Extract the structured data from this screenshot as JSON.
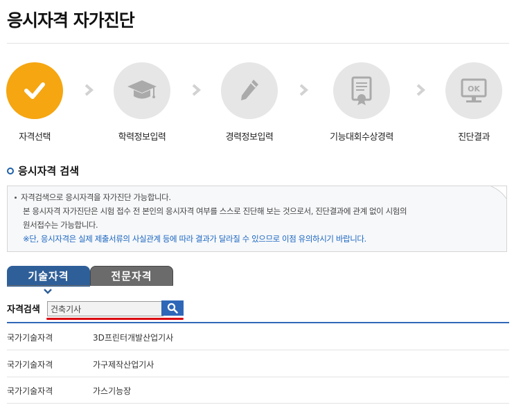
{
  "page": {
    "title": "응시자격 자가진단"
  },
  "steps": [
    {
      "label": "자격선택",
      "icon": "check-icon",
      "active": true
    },
    {
      "label": "학력정보입력",
      "icon": "graduation-cap-icon",
      "active": false
    },
    {
      "label": "경력정보입력",
      "icon": "pencil-icon",
      "active": false
    },
    {
      "label": "기능대회수상경력",
      "icon": "certificate-icon",
      "active": false
    },
    {
      "label": "진단결과",
      "icon": "monitor-ok-icon",
      "active": false
    }
  ],
  "monitor_text": "OK",
  "section": {
    "title": "응시자격 검색"
  },
  "notice": {
    "line1": "자격검색으로 응시자격을 자가진단 가능합니다.",
    "line2": "본 응시자격 자가진단은 시험 접수 전 본인의 응시자격 여부를 스스로 진단해 보는 것으로서, 진단결과에 관계 없이 시험의",
    "line3": "원서접수는 가능합니다.",
    "line4": "※단, 응시자격은 실제 제출서류의 사실관계 등에 따라 결과가 달라질 수 있으므로 이점 유의하시기 바랍니다."
  },
  "tabs": [
    {
      "label": "기술자격",
      "active": true
    },
    {
      "label": "전문자격",
      "active": false
    }
  ],
  "search": {
    "label": "자격검색",
    "value": "건축기사",
    "button_icon": "search-icon"
  },
  "results": [
    {
      "category": "국가기술자격",
      "name": "3D프린터개발산업기사"
    },
    {
      "category": "국가기술자격",
      "name": "가구제작산업기사"
    },
    {
      "category": "국가기술자격",
      "name": "가스기능장"
    }
  ],
  "colors": {
    "accent_orange": "#f5a611",
    "primary_blue": "#2f67b8",
    "tab_blue": "#2f5f98",
    "tab_gray": "#6b6b6b",
    "underline_red": "#d9000d"
  }
}
